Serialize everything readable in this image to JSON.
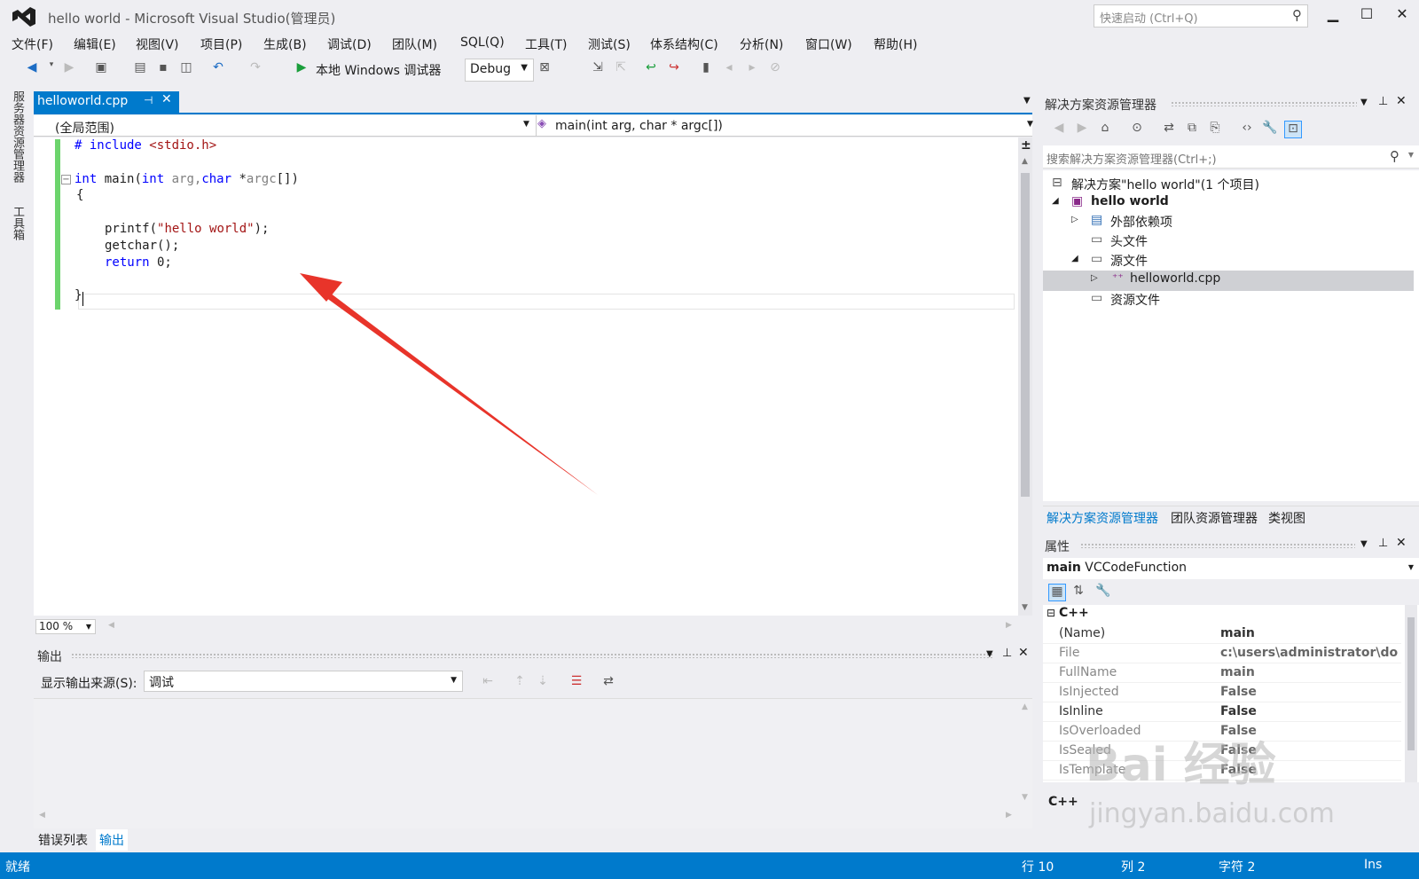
{
  "window": {
    "title": "hello world - Microsoft Visual Studio(管理员)",
    "quick_launch": "快速启动 (Ctrl+Q)"
  },
  "menu": [
    "文件(F)",
    "编辑(E)",
    "视图(V)",
    "项目(P)",
    "生成(B)",
    "调试(D)",
    "团队(M)",
    "SQL(Q)",
    "工具(T)",
    "测试(S)",
    "体系结构(C)",
    "分析(N)",
    "窗口(W)",
    "帮助(H)"
  ],
  "toolbar": {
    "run_label": "本地 Windows 调试器",
    "config": "Debug"
  },
  "left_strip": {
    "server_explorer": "服务器资源管理器",
    "toolbox": "工具箱"
  },
  "editor": {
    "tab": "helloworld.cpp",
    "scope": "(全局范围)",
    "function": "main(int arg, char * argc[])",
    "code": {
      "l1_kw": "# include",
      "l1_rest": " <stdio.h>",
      "l3_int": "int",
      "l3_mid": " main(",
      "l3_int2": "int",
      "l3_arg": " arg,",
      "l3_char": "char",
      "l3_star": " *",
      "l3_argc": "argc",
      "l3_end": "[])",
      "l4": "{",
      "l6_fn": "printf(",
      "l6_str": "\"hello world\"",
      "l6_end": ");",
      "l7": "getchar();",
      "l8_kw": "return",
      "l8_end": " 0;",
      "l10": "}"
    },
    "zoom": "100 %"
  },
  "output": {
    "title": "输出",
    "source_label": "显示输出来源(S):",
    "source_value": "调试",
    "tab_errors": "错误列表",
    "tab_output": "输出"
  },
  "solution": {
    "title": "解决方案资源管理器",
    "search": "搜索解决方案资源管理器(Ctrl+;)",
    "tree": {
      "solution": "解决方案\"hello world\"(1 个项目)",
      "project": "hello world",
      "external": "外部依赖项",
      "headers": "头文件",
      "sources": "源文件",
      "file": "helloworld.cpp",
      "resources": "资源文件"
    },
    "tabs": [
      "解决方案资源管理器",
      "团队资源管理器",
      "类视图"
    ]
  },
  "properties": {
    "title": "属性",
    "object_name": "main",
    "object_type": "VCCodeFunction",
    "category": "C++",
    "rows": [
      {
        "name": "(Name)",
        "value": "main"
      },
      {
        "name": "File",
        "value": "c:\\users\\administrator\\doc"
      },
      {
        "name": "FullName",
        "value": "main"
      },
      {
        "name": "IsInjected",
        "value": "False"
      },
      {
        "name": "IsInline",
        "value": "False"
      },
      {
        "name": "IsOverloaded",
        "value": "False"
      },
      {
        "name": "IsSealed",
        "value": "False"
      },
      {
        "name": "IsTemplate",
        "value": "False"
      }
    ],
    "desc_title": "C++"
  },
  "status": {
    "ready": "就绪",
    "line": "行 10",
    "col": "列 2",
    "char": "字符 2",
    "ins": "Ins"
  },
  "watermark": {
    "brand": "Bai  经验",
    "url": "jingyan.baidu.com"
  },
  "colors": {
    "accent": "#007acc",
    "keyword": "#0000ff",
    "string": "#a31515",
    "arrow": "#e8342a"
  }
}
